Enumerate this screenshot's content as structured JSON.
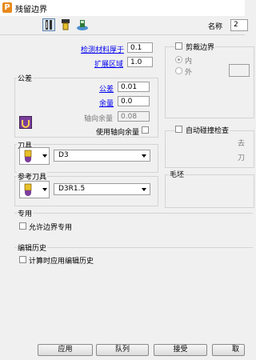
{
  "window": {
    "title": "残留边界"
  },
  "toolbar": {
    "name_label": "名称",
    "name_value": "2"
  },
  "main": {
    "thickness": {
      "label": "检测材料厚于",
      "value": "0.1"
    },
    "expand": {
      "label": "扩展区域",
      "value": "1.0"
    }
  },
  "tolerance": {
    "title": "公差",
    "tolerance_label": "公差",
    "tolerance_value": "0.01",
    "allowance_label": "余量",
    "allowance_value": "0.0",
    "axial_label": "轴向余量",
    "axial_value": "0.08",
    "use_axial_label": "使用轴向余量"
  },
  "trim": {
    "title": "剪裁边界",
    "inner": "内",
    "outer": "外"
  },
  "collision": {
    "title": "自动碰撞检查",
    "right1": "去",
    "right2": "刀"
  },
  "tool": {
    "title": "刀具",
    "value": "D3"
  },
  "ref_tool": {
    "title": "参考刀具",
    "value": "D3R1.5"
  },
  "blank": {
    "title": "毛坯"
  },
  "special": {
    "title": "专用",
    "allow_label": "允许边界专用"
  },
  "history": {
    "title": "编辑历史",
    "apply_label": "计算时应用编辑历史"
  },
  "buttons": {
    "apply": "应用",
    "queue": "队列",
    "accept": "接受",
    "cancel": "取消"
  },
  "icons": {
    "app": "P",
    "toolbar": [
      "boundary-params-icon",
      "tool-holder-icon",
      "tool-shape-icon"
    ]
  }
}
